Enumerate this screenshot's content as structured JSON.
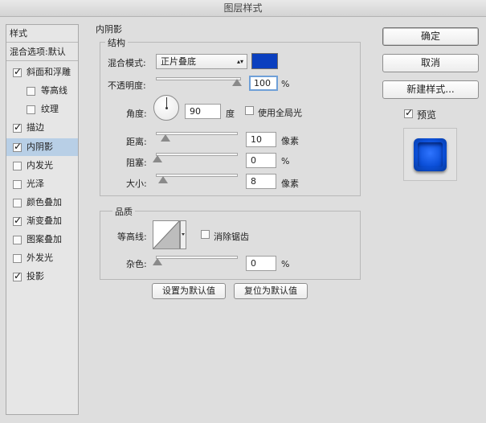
{
  "window": {
    "title": "图层样式"
  },
  "sidebar": {
    "items": [
      {
        "label": "样式",
        "checkbox": false
      },
      {
        "label": "混合选项:默认",
        "checkbox": false
      },
      {
        "label": "斜面和浮雕",
        "checkbox": true,
        "checked": true
      },
      {
        "label": "等高线",
        "checkbox": true,
        "checked": false,
        "indent": true
      },
      {
        "label": "纹理",
        "checkbox": true,
        "checked": false,
        "indent": true
      },
      {
        "label": "描边",
        "checkbox": true,
        "checked": true
      },
      {
        "label": "内阴影",
        "checkbox": true,
        "checked": true,
        "active": true
      },
      {
        "label": "内发光",
        "checkbox": true,
        "checked": false
      },
      {
        "label": "光泽",
        "checkbox": true,
        "checked": false
      },
      {
        "label": "颜色叠加",
        "checkbox": true,
        "checked": false
      },
      {
        "label": "渐变叠加",
        "checkbox": true,
        "checked": true
      },
      {
        "label": "图案叠加",
        "checkbox": true,
        "checked": false
      },
      {
        "label": "外发光",
        "checkbox": true,
        "checked": false
      },
      {
        "label": "投影",
        "checkbox": true,
        "checked": true
      }
    ]
  },
  "inner_shadow": {
    "section_title": "内阴影",
    "structure": {
      "title": "结构",
      "blend_mode_label": "混合模式:",
      "blend_mode_value": "正片叠底",
      "blend_color": "#0a3fbf",
      "opacity_label": "不透明度:",
      "opacity_value": "100",
      "opacity_unit": "%",
      "opacity_level": 1.0,
      "angle_label": "角度:",
      "angle_value": "90",
      "angle_unit": "度",
      "global_light_label": "使用全局光",
      "global_light_checked": false,
      "distance_label": "距离:",
      "distance_value": "10",
      "distance_unit": "像素",
      "choke_label": "阻塞:",
      "choke_value": "0",
      "choke_unit": "%",
      "size_label": "大小:",
      "size_value": "8",
      "size_unit": "像素"
    },
    "quality": {
      "title": "品质",
      "contour_label": "等高线:",
      "anti_alias_label": "消除锯齿",
      "anti_alias_checked": false,
      "noise_label": "杂色:",
      "noise_value": "0",
      "noise_unit": "%"
    },
    "set_default_label": "设置为默认值",
    "reset_default_label": "复位为默认值"
  },
  "buttons": {
    "ok": "确定",
    "cancel": "取消",
    "new_style": "新建样式...",
    "preview_label": "预览",
    "preview_checked": true
  },
  "colors": {
    "accent": "#0a3fbf",
    "selection": "#b8cfe6"
  }
}
